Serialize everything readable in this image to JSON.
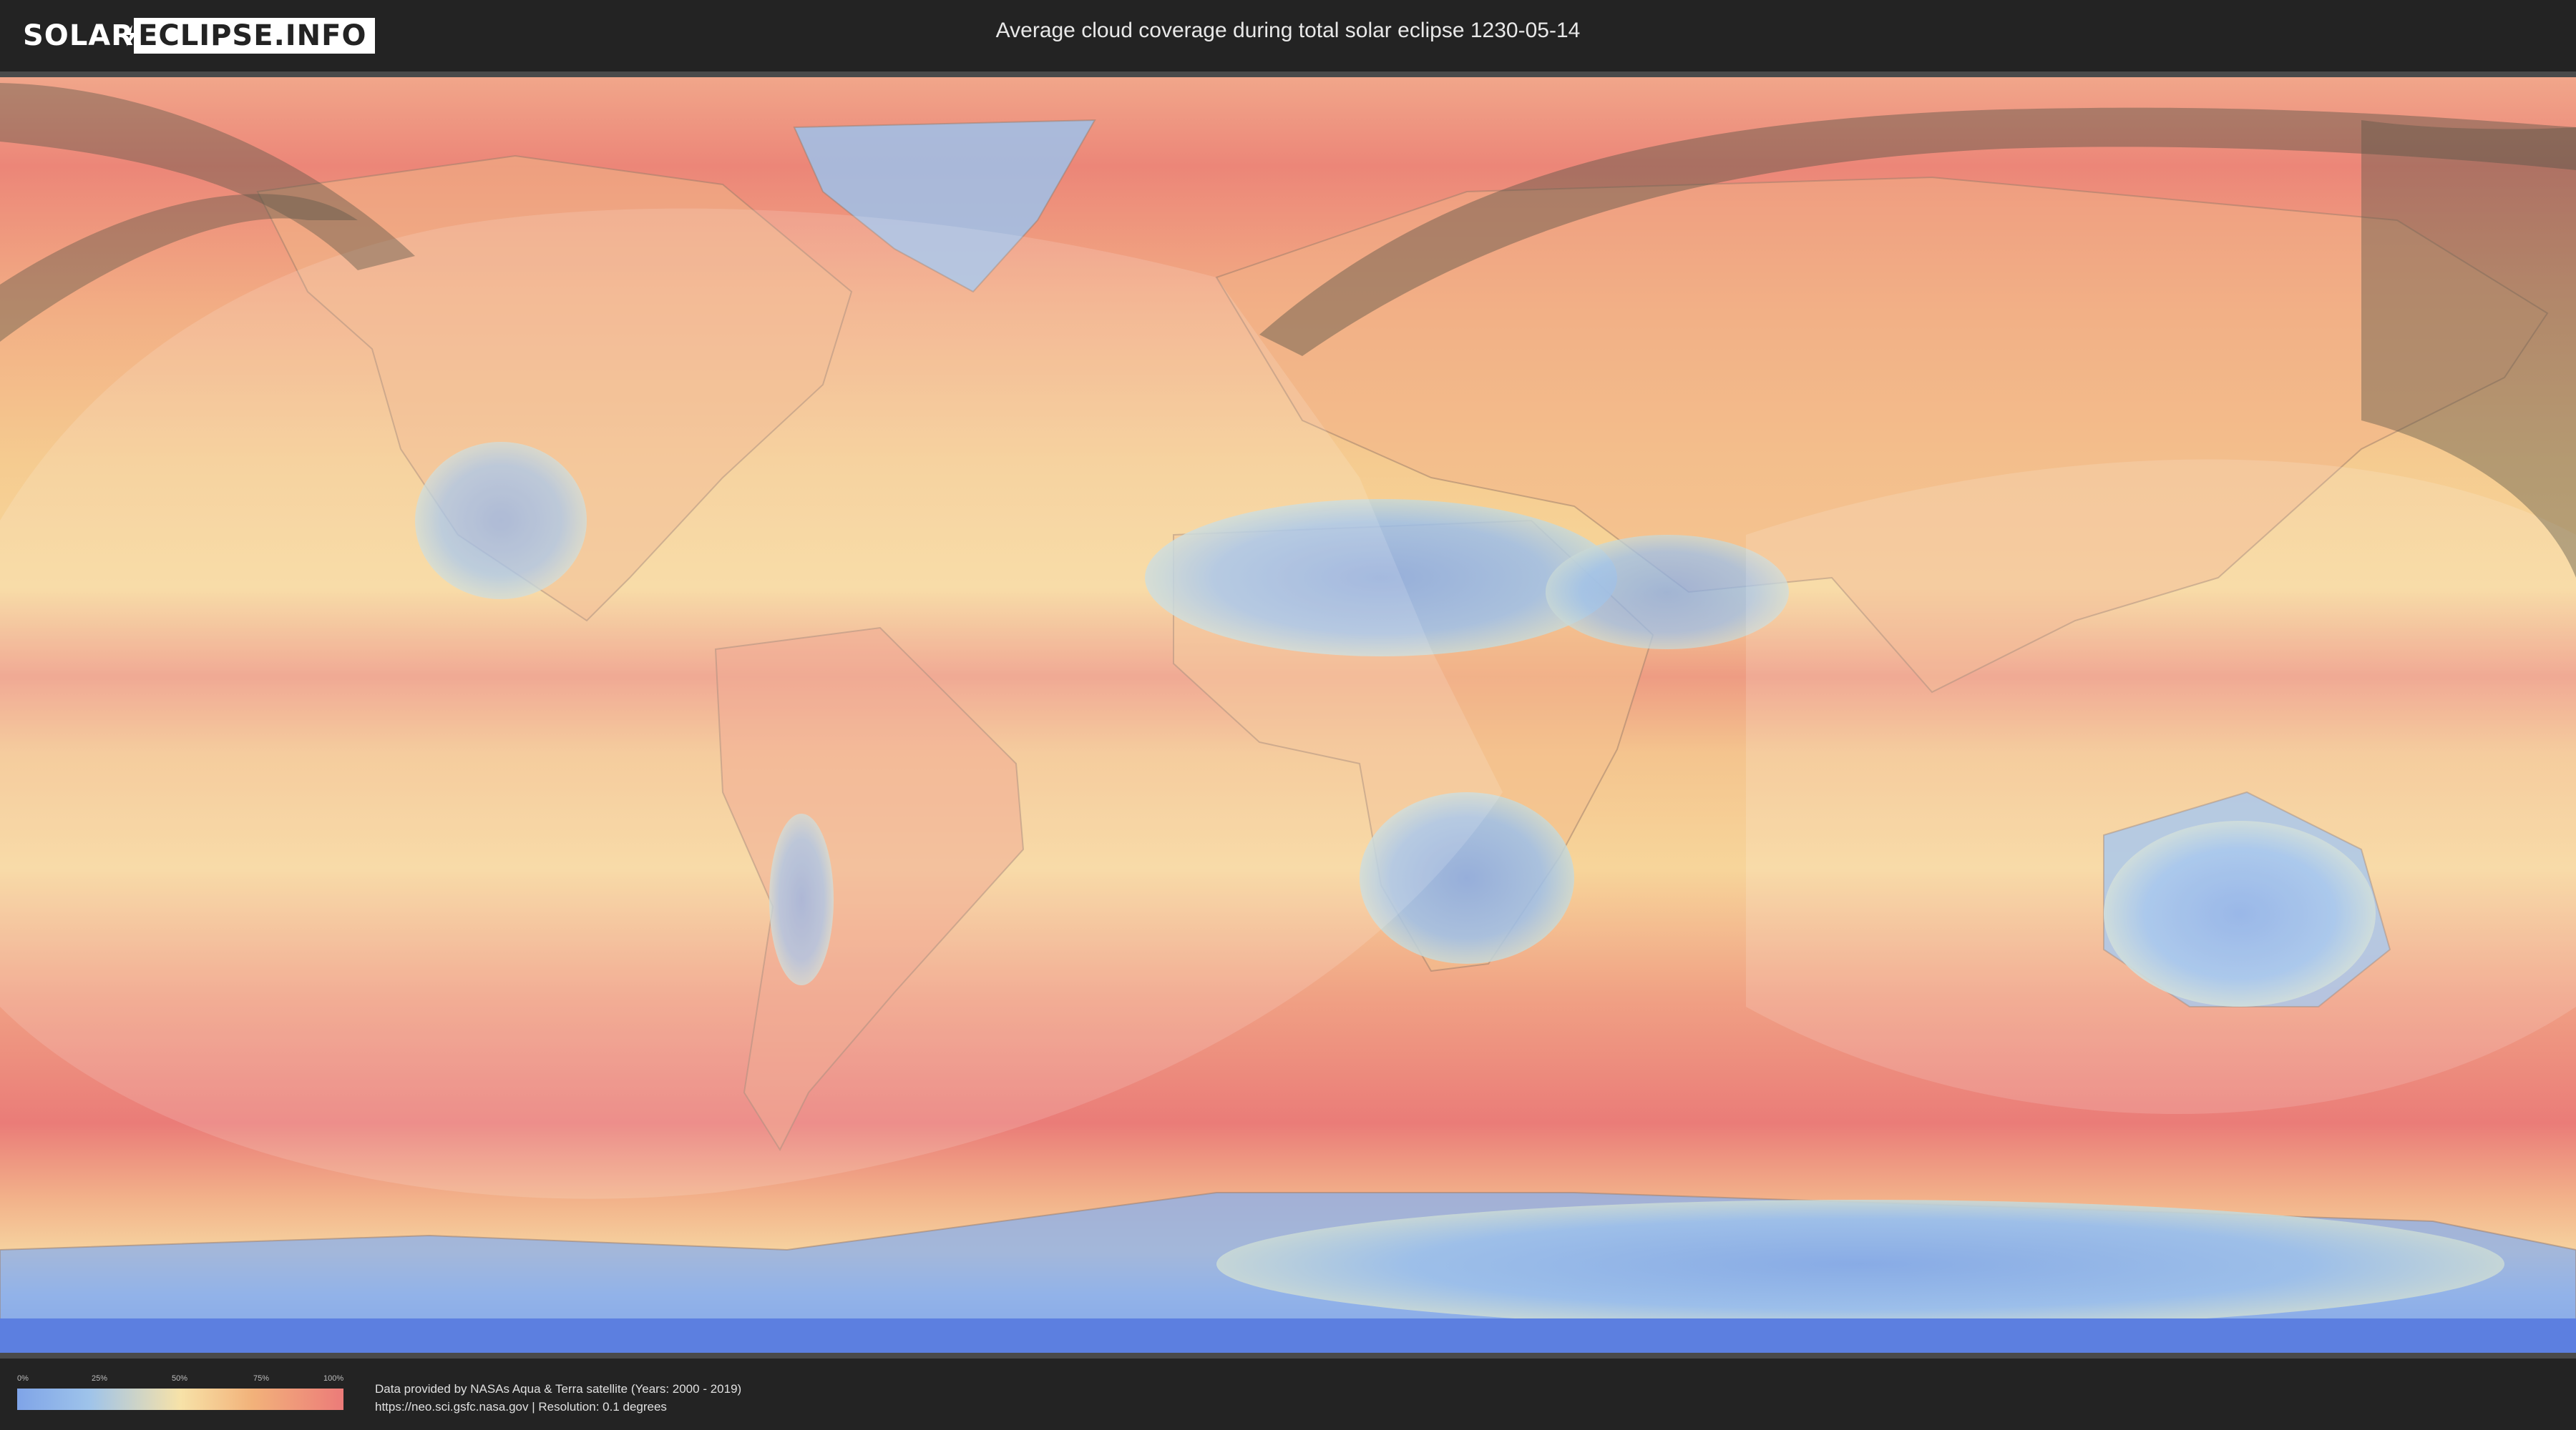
{
  "header": {
    "logo_left": "SOLAR",
    "logo_right": "ECLIPSE.INFO",
    "title": "Average cloud coverage during total solar eclipse 1230-05-14"
  },
  "legend": {
    "ticks": [
      "0%",
      "25%",
      "50%",
      "75%",
      "100%"
    ],
    "colors": [
      "#7fa4e8",
      "#f7e2a8",
      "#ec7b79"
    ]
  },
  "footer": {
    "credit_line1": "Data provided by NASAs Aqua & Terra satellite (Years: 2000 - 2019)",
    "credit_line2": "https://neo.sci.gsfc.nasa.gov | Resolution: 0.1 degrees"
  },
  "map": {
    "eclipse_year": "1230-05-14",
    "overlay": "eclipse-path",
    "colors": {
      "ocean_clear": "#f4c98a",
      "clouds_high": "#ec7b79",
      "clear_land": "#8fb3e6",
      "ice": "#5c7fe0",
      "path_shade": "#5a5548"
    }
  }
}
